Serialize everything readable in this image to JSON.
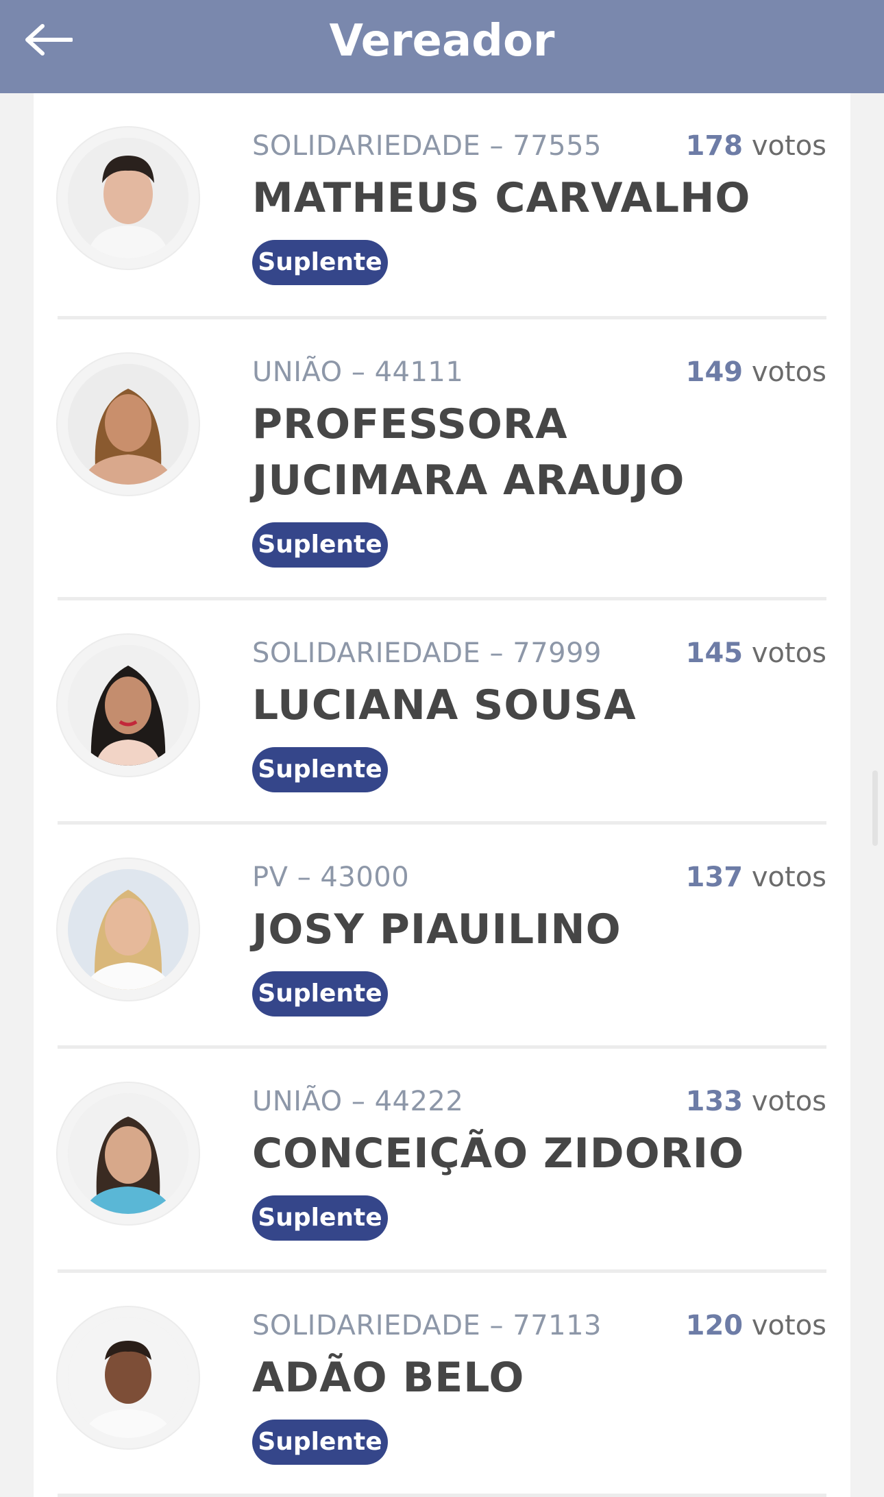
{
  "header": {
    "title": "Vereador",
    "back_icon": "arrow-left-icon"
  },
  "candidates": [
    {
      "party": "SOLIDARIEDADE – 77555",
      "name": "MATHEUS CARVALHO",
      "votes": "178",
      "votes_unit": "votos",
      "status": "Suplente"
    },
    {
      "party": "UNIÃO – 44111",
      "name": "PROFESSORA JUCIMARA ARAUJO",
      "votes": "149",
      "votes_unit": "votos",
      "status": "Suplente"
    },
    {
      "party": "SOLIDARIEDADE – 77999",
      "name": "LUCIANA SOUSA",
      "votes": "145",
      "votes_unit": "votos",
      "status": "Suplente"
    },
    {
      "party": "PV – 43000",
      "name": "JOSY PIAUILINO",
      "votes": "137",
      "votes_unit": "votos",
      "status": "Suplente"
    },
    {
      "party": "UNIÃO – 44222",
      "name": "CONCEIÇÃO ZIDORIO",
      "votes": "133",
      "votes_unit": "votos",
      "status": "Suplente"
    },
    {
      "party": "SOLIDARIEDADE – 77113",
      "name": "ADÃO BELO",
      "votes": "120",
      "votes_unit": "votos",
      "status": "Suplente"
    }
  ],
  "colors": {
    "header_bg": "#7a88ad",
    "badge_bg": "#35468a",
    "votes_number": "#6d7ca6",
    "party_text": "#8d97a8",
    "name_text": "#464646"
  }
}
